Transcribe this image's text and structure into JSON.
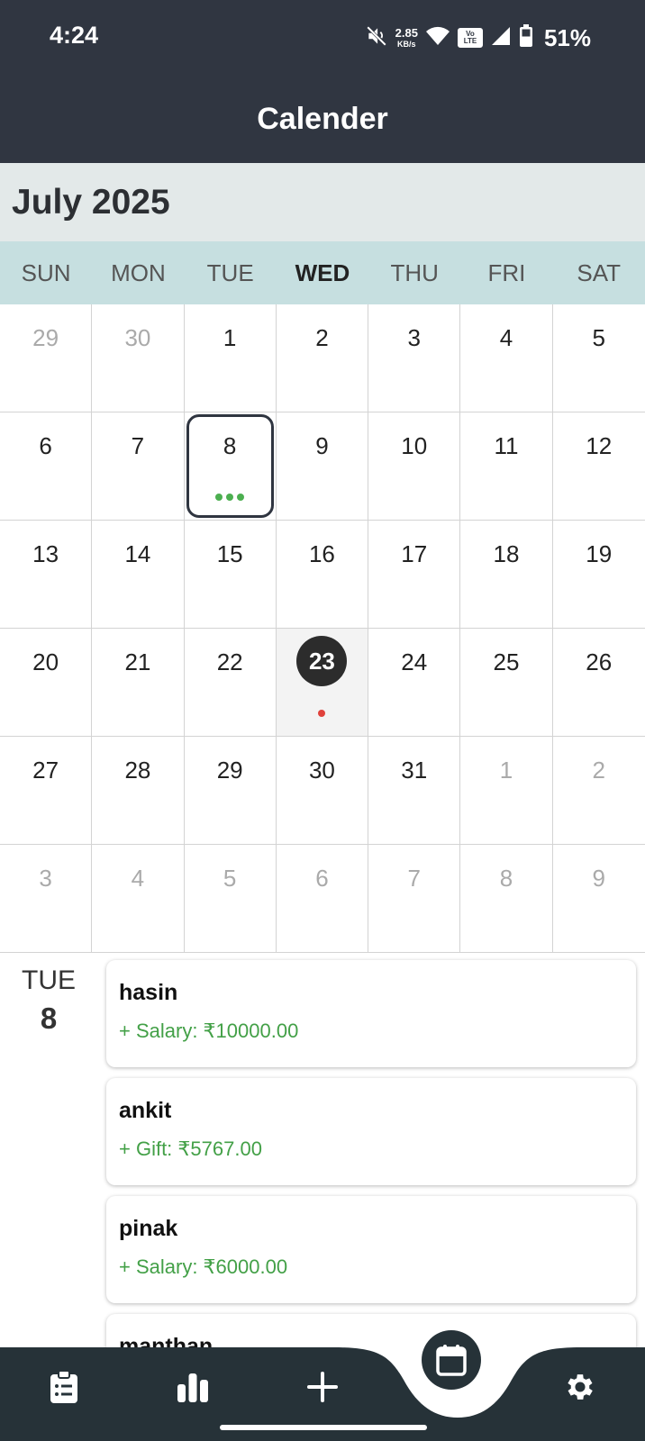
{
  "status_bar": {
    "time": "4:24",
    "net_speed_value": "2.85",
    "net_speed_unit": "KB/s",
    "volte_top": "Vo",
    "volte_bottom": "LTE",
    "battery": "51%",
    "icons": [
      "mute-icon",
      "wifi-icon",
      "volte-icon",
      "signal-icon",
      "battery-icon"
    ]
  },
  "app_bar": {
    "title": "Calender"
  },
  "calendar": {
    "month_title": "July 2025",
    "weekdays": [
      "SUN",
      "MON",
      "TUE",
      "WED",
      "THU",
      "FRI",
      "SAT"
    ],
    "today_weekday": "WED",
    "weeks": [
      [
        "29",
        "30",
        "1",
        "2",
        "3",
        "4",
        "5"
      ],
      [
        "6",
        "7",
        "8",
        "9",
        "10",
        "11",
        "12"
      ],
      [
        "13",
        "14",
        "15",
        "16",
        "17",
        "18",
        "19"
      ],
      [
        "20",
        "21",
        "22",
        "23",
        "24",
        "25",
        "26"
      ],
      [
        "27",
        "28",
        "29",
        "30",
        "31",
        "1",
        "2"
      ],
      [
        "3",
        "4",
        "5",
        "6",
        "7",
        "8",
        "9"
      ]
    ],
    "selected_day": "8",
    "today": "23",
    "colors": {
      "income_dot": "#4caf50",
      "today_dot": "#e0413b",
      "header_bg": "#303641",
      "weekday_bg": "#c6dfe0"
    }
  },
  "events": {
    "day_of_week": "TUE",
    "day_number": "8",
    "items": [
      {
        "name": "hasin",
        "amount": "+ Salary: ₹10000.00"
      },
      {
        "name": "ankit",
        "amount": "+ Gift: ₹5767.00"
      },
      {
        "name": "pinak",
        "amount": "+ Salary: ₹6000.00"
      },
      {
        "name": "manthan",
        "amount": ""
      }
    ]
  },
  "bottom_nav": {
    "items": [
      "transactions-icon",
      "stats-icon",
      "add-icon",
      "calendar-icon",
      "settings-icon"
    ],
    "active": "calendar-icon"
  }
}
